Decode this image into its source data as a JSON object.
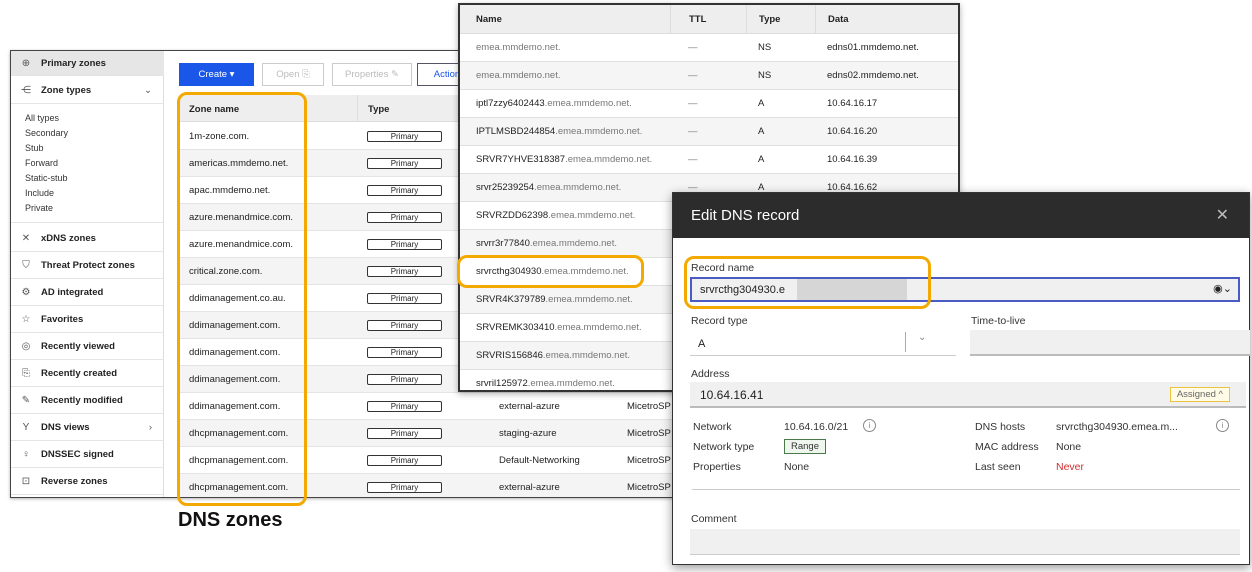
{
  "sidebar": {
    "primary_zones": "Primary zones",
    "zone_types": "Zone types",
    "zone_type_items": [
      "All types",
      "Secondary",
      "Stub",
      "Forward",
      "Static-stub",
      "Include",
      "Private"
    ],
    "items": [
      {
        "label": "xDNS zones",
        "icon": "✕"
      },
      {
        "label": "Threat Protect zones",
        "icon": "⛉"
      },
      {
        "label": "AD integrated",
        "icon": "⚙"
      },
      {
        "label": "Favorites",
        "icon": "☆"
      },
      {
        "label": "Recently viewed",
        "icon": "◎"
      },
      {
        "label": "Recently created",
        "icon": "⎘"
      },
      {
        "label": "Recently modified",
        "icon": "✎"
      },
      {
        "label": "DNS views",
        "icon": "Y",
        "chevron": "›"
      },
      {
        "label": "DNSSEC signed",
        "icon": "♀"
      },
      {
        "label": "Reverse zones",
        "icon": "⊡"
      }
    ]
  },
  "toolbar": {
    "create": "Create ▾",
    "open": "Open ⎘",
    "properties": "Properties ✎",
    "action": "Action"
  },
  "zones": {
    "headers": [
      "Zone name",
      "Type"
    ],
    "rows": [
      {
        "name": "1m-zone.com.",
        "type": "Primary"
      },
      {
        "name": "americas.mmdemo.net.",
        "type": "Primary"
      },
      {
        "name": "apac.mmdemo.net.",
        "type": "Primary"
      },
      {
        "name": "azure.menandmice.com.",
        "type": "Primary"
      },
      {
        "name": "azure.menandmice.com.",
        "type": "Primary"
      },
      {
        "name": "critical.zone.com.",
        "type": "Primary"
      },
      {
        "name": "ddimanagement.co.au.",
        "type": "Primary"
      },
      {
        "name": "ddimanagement.com.",
        "type": "Primary"
      },
      {
        "name": "ddimanagement.com.",
        "type": "Primary"
      },
      {
        "name": "ddimanagement.com.",
        "type": "Primary"
      },
      {
        "name": "ddimanagement.com.",
        "type": "Primary",
        "view": "external-azure",
        "server": "MicetroSP"
      },
      {
        "name": "dhcpmanagement.com.",
        "type": "Primary",
        "view": "staging-azure",
        "server": "MicetroSP"
      },
      {
        "name": "dhcpmanagement.com.",
        "type": "Primary",
        "view": "Default-Networking",
        "server": "MicetroSP"
      },
      {
        "name": "dhcpmanagement.com.",
        "type": "Primary",
        "view": "external-azure",
        "server": "MicetroSP"
      }
    ]
  },
  "caption": "DNS zones",
  "records": {
    "headers": [
      "Name",
      "TTL",
      "Type",
      "Data"
    ],
    "rows": [
      {
        "host": "",
        "zone": "emea.mmdemo.net.",
        "ttl": "—",
        "type": "NS",
        "data": "edns01.mmdemo.net."
      },
      {
        "host": "",
        "zone": "emea.mmdemo.net.",
        "ttl": "—",
        "type": "NS",
        "data": "edns02.mmdemo.net."
      },
      {
        "host": "iptl7zzy6402443",
        "zone": ".emea.mmdemo.net.",
        "ttl": "—",
        "type": "A",
        "data": "10.64.16.17"
      },
      {
        "host": "IPTLMSBD244854",
        "zone": ".emea.mmdemo.net.",
        "ttl": "—",
        "type": "A",
        "data": "10.64.16.20"
      },
      {
        "host": "SRVR7YHVE318387",
        "zone": ".emea.mmdemo.net.",
        "ttl": "—",
        "type": "A",
        "data": "10.64.16.39"
      },
      {
        "host": "srvr25239254",
        "zone": ".emea.mmdemo.net.",
        "ttl": "—",
        "type": "A",
        "data": "10.64.16.62"
      },
      {
        "host": "SRVRZDD62398",
        "zone": ".emea.mmdemo.net.",
        "ttl": "",
        "type": "",
        "data": ""
      },
      {
        "host": "srvrr3r77840",
        "zone": ".emea.mmdemo.net.",
        "ttl": "",
        "type": "",
        "data": ""
      },
      {
        "host": "srvrcthg304930",
        "zone": ".emea.mmdemo.net.",
        "ttl": "",
        "type": "",
        "data": ""
      },
      {
        "host": "SRVR4K379789",
        "zone": ".emea.mmdemo.net.",
        "ttl": "",
        "type": "",
        "data": ""
      },
      {
        "host": "SRVREMK303410",
        "zone": ".emea.mmdemo.net.",
        "ttl": "",
        "type": "",
        "data": ""
      },
      {
        "host": "SRVRIS156846",
        "zone": ".emea.mmdemo.net.",
        "ttl": "",
        "type": "",
        "data": ""
      },
      {
        "host": "srvril125972",
        "zone": ".emea.mmdemo.net.",
        "ttl": "",
        "type": "",
        "data": ""
      }
    ]
  },
  "dialog": {
    "title": "Edit DNS record",
    "close": "✕",
    "record_name_label": "Record name",
    "record_name_value": "srvrcthg304930.e",
    "record_type_label": "Record type",
    "record_type_value": "A",
    "ttl_label": "Time-to-live",
    "address_label": "Address",
    "address_value": "10.64.16.41",
    "assigned": "Assigned ^",
    "network_label": "Network",
    "network_value": "10.64.16.0/21",
    "network_type_label": "Network type",
    "network_type_value": "Range",
    "properties_label": "Properties",
    "properties_value": "None",
    "dns_hosts_label": "DNS hosts",
    "dns_hosts_value": "srvrcthg304930.emea.m...",
    "mac_label": "MAC address",
    "mac_value": "None",
    "last_seen_label": "Last seen",
    "last_seen_value": "Never",
    "comment_label": "Comment"
  },
  "colors": {
    "accent": "#1a56e8",
    "highlight": "#f4a900",
    "danger": "#d32f2f",
    "titlebar": "#2c2c2c"
  }
}
